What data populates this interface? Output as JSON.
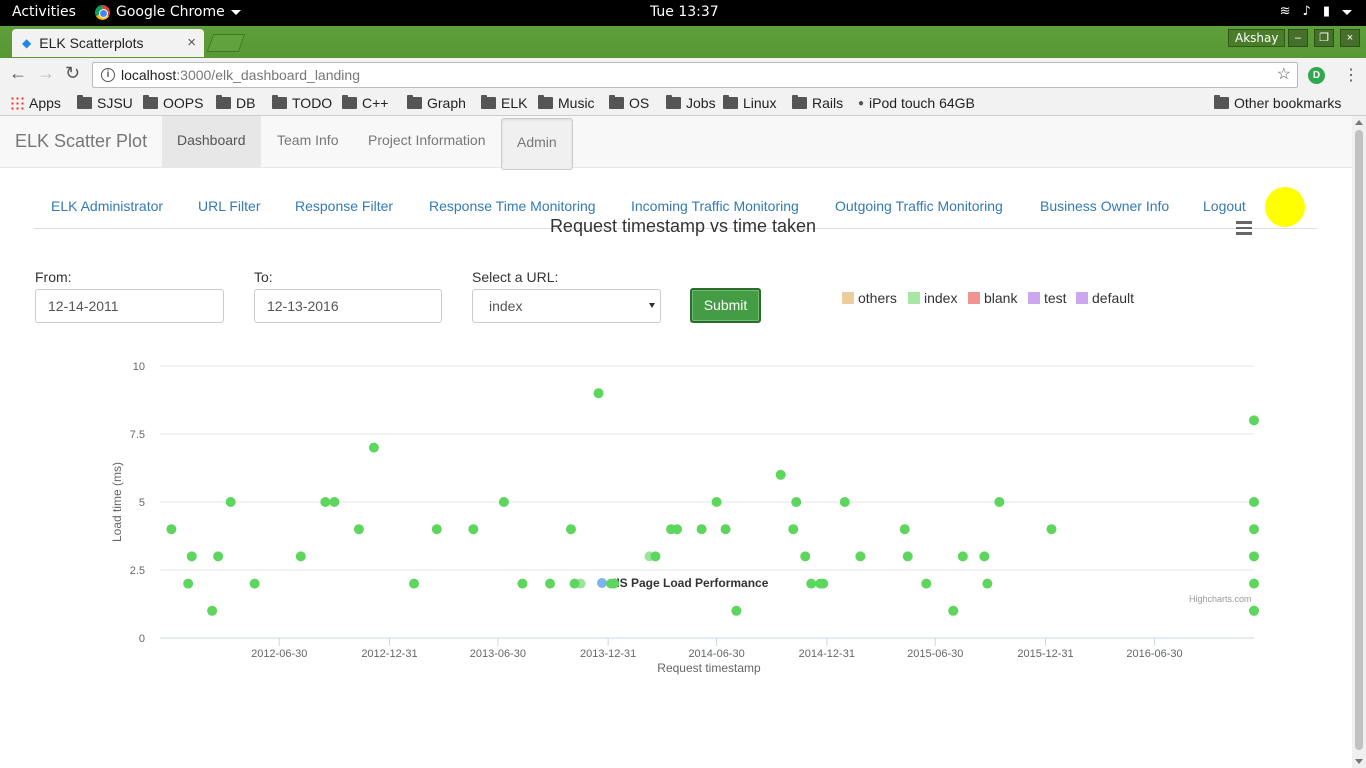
{
  "system": {
    "activities": "Activities",
    "app_name": "Google Chrome",
    "clock": "Tue 13:37"
  },
  "browser": {
    "tab_title": "ELK Scatterplots",
    "user": "Akshay",
    "url_host": "localhost",
    "url_path": ":3000/elk_dashboard_landing",
    "bookmarks": [
      "Apps",
      "SJSU",
      "OOPS",
      "DB",
      "TODO",
      "C++",
      "Graph",
      "ELK",
      "Music",
      "OS",
      "Jobs",
      "Linux",
      "Rails",
      "iPod touch 64GB"
    ],
    "other_bookmarks": "Other bookmarks"
  },
  "navbar": {
    "brand": "ELK Scatter Plot",
    "items": [
      "Dashboard",
      "Team Info",
      "Project Information",
      "Admin"
    ]
  },
  "subnav": {
    "links": [
      "ELK Administrator",
      "URL Filter",
      "Response Filter",
      "Response Time Monitoring",
      "Incoming Traffic Monitoring",
      "Outgoing Traffic Monitoring",
      "Business Owner Info",
      "Logout"
    ]
  },
  "form": {
    "from_label": "From:",
    "from_value": "12-14-2011",
    "to_label": "To:",
    "to_value": "12-13-2016",
    "url_label": "Select a URL:",
    "url_value": "index",
    "submit_label": "Submit"
  },
  "url_legend": [
    {
      "label": "others",
      "color": "#edcc9e"
    },
    {
      "label": "index",
      "color": "#a8e6a3"
    },
    {
      "label": "blank",
      "color": "#f19490"
    },
    {
      "label": "test",
      "color": "#cca6ef"
    },
    {
      "label": "default",
      "color": "#cca6ef"
    }
  ],
  "chart_data": {
    "type": "scatter",
    "title": "Request timestamp vs time taken",
    "xlabel": "Request timestamp",
    "ylabel": "Load time (ms)",
    "ylim": [
      0,
      10
    ],
    "yticks": [
      "0",
      "2.5",
      "5",
      "7.5",
      "10"
    ],
    "xlim": [
      "2011-12-14",
      "2016-12-13"
    ],
    "xticks": [
      "2012-06-30",
      "2012-12-31",
      "2013-06-30",
      "2013-12-31",
      "2014-06-30",
      "2014-12-31",
      "2015-06-30",
      "2015-12-31",
      "2016-06-30"
    ],
    "grid": true,
    "legend_position": "bottom-center",
    "series": [
      {
        "name": "IIS Page Load Performance",
        "legend_color": "#7cb5ec",
        "point_color": "#5cd65c",
        "points": [
          [
            "2012-01-02",
            4
          ],
          [
            "2012-01-30",
            2
          ],
          [
            "2012-02-05",
            3
          ],
          [
            "2012-03-10",
            1
          ],
          [
            "2012-03-20",
            3
          ],
          [
            "2012-04-10",
            5
          ],
          [
            "2012-05-20",
            2
          ],
          [
            "2012-08-05",
            3
          ],
          [
            "2012-09-15",
            5
          ],
          [
            "2012-09-30",
            5
          ],
          [
            "2012-11-10",
            4
          ],
          [
            "2012-12-05",
            7
          ],
          [
            "2013-02-10",
            2
          ],
          [
            "2013-03-20",
            4
          ],
          [
            "2013-05-20",
            4
          ],
          [
            "2013-07-10",
            5
          ],
          [
            "2013-08-10",
            2
          ],
          [
            "2013-09-25",
            2
          ],
          [
            "2013-10-30",
            4
          ],
          [
            "2013-11-05",
            2
          ],
          [
            "2013-12-15",
            9
          ],
          [
            "2014-01-05",
            2
          ],
          [
            "2014-01-10",
            2
          ],
          [
            "2014-03-20",
            3
          ],
          [
            "2014-04-15",
            4
          ],
          [
            "2014-04-25",
            4
          ],
          [
            "2014-06-05",
            4
          ],
          [
            "2014-06-30",
            5
          ],
          [
            "2014-07-15",
            4
          ],
          [
            "2014-08-02",
            1
          ],
          [
            "2014-10-15",
            6
          ],
          [
            "2014-11-05",
            4
          ],
          [
            "2014-11-10",
            5
          ],
          [
            "2014-11-25",
            3
          ],
          [
            "2014-12-05",
            2
          ],
          [
            "2014-12-20",
            2
          ],
          [
            "2014-12-25",
            2
          ],
          [
            "2015-01-30",
            5
          ],
          [
            "2015-02-25",
            3
          ],
          [
            "2015-05-10",
            4
          ],
          [
            "2015-05-15",
            3
          ],
          [
            "2015-06-15",
            2
          ],
          [
            "2015-07-30",
            1
          ],
          [
            "2015-08-15",
            3
          ],
          [
            "2015-09-20",
            3
          ],
          [
            "2015-09-25",
            2
          ],
          [
            "2015-10-15",
            5
          ],
          [
            "2016-01-10",
            4
          ],
          [
            "2016-12-13",
            8
          ],
          [
            "2016-12-13",
            5
          ],
          [
            "2016-12-13",
            4
          ],
          [
            "2016-12-13",
            3
          ],
          [
            "2016-12-13",
            2
          ],
          [
            "2016-12-13",
            1
          ]
        ],
        "faded_points": [
          [
            "2013-11-15",
            2
          ],
          [
            "2014-03-10",
            3
          ],
          [
            "2016-12-13",
            1
          ]
        ]
      }
    ]
  },
  "credits": "Highcharts.com"
}
